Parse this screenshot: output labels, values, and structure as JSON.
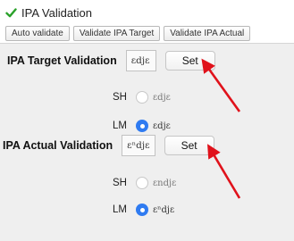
{
  "window": {
    "title": "IPA Validation",
    "check_icon": "checkmark-icon"
  },
  "toolbar": {
    "buttons": [
      "Auto validate",
      "Validate IPA Target",
      "Validate IPA Actual"
    ]
  },
  "target": {
    "heading": "IPA Target Validation",
    "value": "ɛdjɛ",
    "set_label": "Set",
    "options": [
      {
        "label": "SH",
        "text": "ɛdjɛ",
        "selected": false
      },
      {
        "label": "LM",
        "text": "ɛdjɛ",
        "selected": true
      }
    ]
  },
  "actual": {
    "heading": "IPA Actual Validation",
    "value": "ɛⁿdjɛ",
    "set_label": "Set",
    "options": [
      {
        "label": "SH",
        "text": "ɛndjɛ",
        "selected": false
      },
      {
        "label": "LM",
        "text": "ɛⁿdjɛ",
        "selected": true
      }
    ]
  },
  "colors": {
    "accent": "#2f7bf1",
    "annotation_arrow": "#e0121b",
    "check": "#2aa12a"
  },
  "annotations": [
    "red-arrow-icon",
    "red-arrow-icon"
  ]
}
